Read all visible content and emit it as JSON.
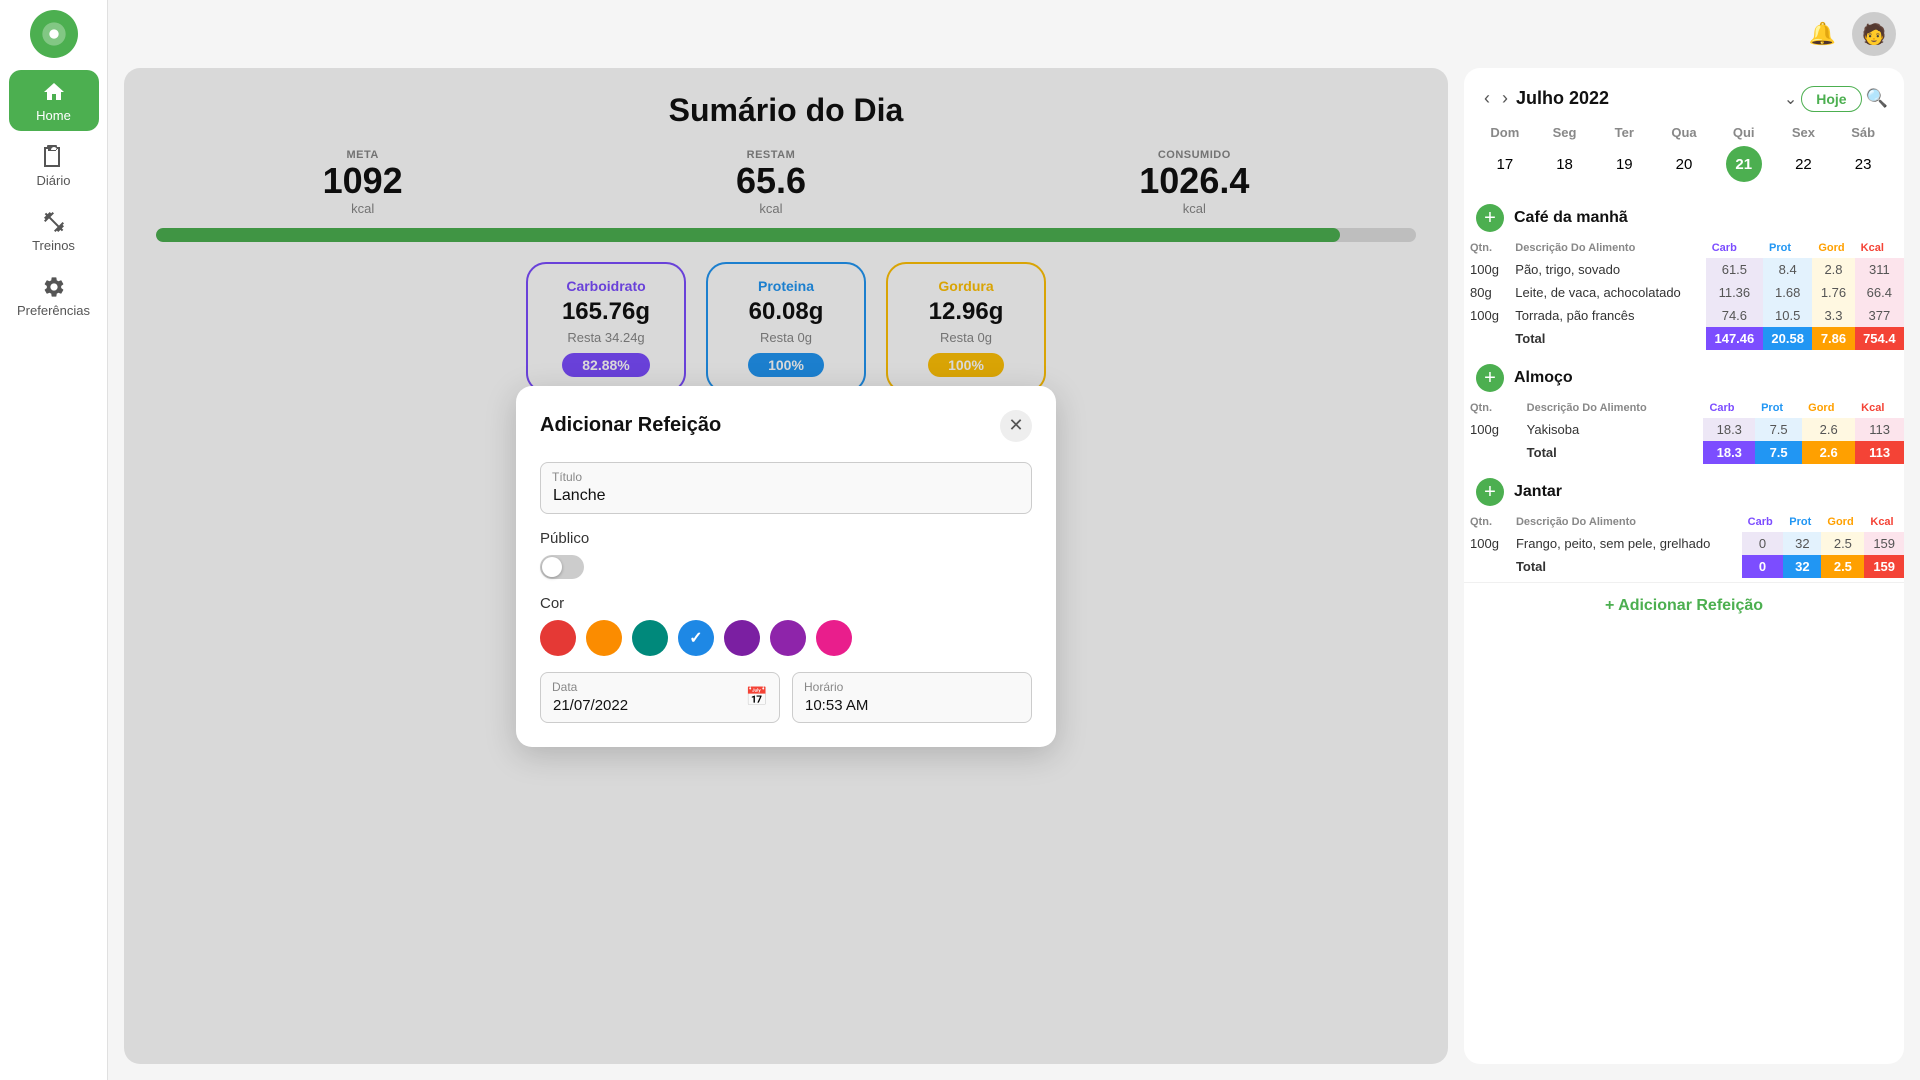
{
  "sidebar": {
    "logo_alt": "App Logo",
    "items": [
      {
        "id": "home",
        "label": "Home",
        "active": true
      },
      {
        "id": "diario",
        "label": "Diário",
        "active": false
      },
      {
        "id": "treinos",
        "label": "Treinos",
        "active": false
      },
      {
        "id": "preferencias",
        "label": "Preferências",
        "active": false
      }
    ]
  },
  "header": {
    "bell_icon": "🔔",
    "avatar_icon": "👤"
  },
  "summary": {
    "title": "Sumário do Dia",
    "meta_label": "META",
    "meta_value": "1092",
    "meta_unit": "kcal",
    "restam_label": "RESTAM",
    "restam_value": "65.6",
    "restam_unit": "kcal",
    "consumido_label": "CONSUMIDO",
    "consumido_value": "1026.4",
    "consumido_unit": "kcal",
    "progress_percent": 94,
    "macros": [
      {
        "id": "carb",
        "name": "Carboidrato",
        "value": "165.76g",
        "rest": "Resta 34.24g",
        "pct": "82.88%"
      },
      {
        "id": "prot",
        "name": "Proteina",
        "value": "60.08g",
        "rest": "Resta 0g",
        "pct": "100%"
      },
      {
        "id": "gord",
        "name": "Gordura",
        "value": "12.96g",
        "rest": "Resta 0g",
        "pct": "100%"
      }
    ]
  },
  "modal": {
    "title": "Adicionar Refeição",
    "titulo_label": "Título",
    "titulo_value": "Lanche",
    "publico_label": "Público",
    "cor_label": "Cor",
    "colors": [
      {
        "id": "red",
        "hex": "#e53935",
        "selected": false
      },
      {
        "id": "orange",
        "hex": "#fb8c00",
        "selected": false
      },
      {
        "id": "green",
        "hex": "#00897b",
        "selected": false
      },
      {
        "id": "blue-check",
        "hex": "#1e88e5",
        "selected": true
      },
      {
        "id": "purple",
        "hex": "#7b1fa2",
        "selected": false
      },
      {
        "id": "violet",
        "hex": "#8e24aa",
        "selected": false
      },
      {
        "id": "pink",
        "hex": "#e91e8c",
        "selected": false
      }
    ],
    "data_label": "Data",
    "data_value": "21/07/2022",
    "horario_label": "Horário",
    "horario_value": "10:53 AM"
  },
  "calendar": {
    "month_year": "Julho 2022",
    "today_btn": "Hoje",
    "day_headers": [
      "Dom",
      "Seg",
      "Ter",
      "Qua",
      "Qui",
      "Sex",
      "Sáb"
    ],
    "days": [
      17,
      18,
      19,
      20,
      21,
      22,
      23
    ],
    "today_day": 21
  },
  "meals": [
    {
      "id": "cafe",
      "name": "Café da manhã",
      "headers": {
        "qtn": "Qtn.",
        "desc": "Descrição Do Alimento",
        "carb": "Carb",
        "prot": "Prot",
        "gord": "Gord",
        "kcal": "Kcal"
      },
      "items": [
        {
          "qtn": "100g",
          "desc": "Pão, trigo, sovado",
          "carb": "61.5",
          "prot": "8.4",
          "gord": "2.8",
          "kcal": "311"
        },
        {
          "qtn": "80g",
          "desc": "Leite, de vaca, achocolatado",
          "carb": "11.36",
          "prot": "1.68",
          "gord": "1.76",
          "kcal": "66.4"
        },
        {
          "qtn": "100g",
          "desc": "Torrada, pão francês",
          "carb": "74.6",
          "prot": "10.5",
          "gord": "3.3",
          "kcal": "377"
        }
      ],
      "total": {
        "label": "Total",
        "carb": "147.46",
        "prot": "20.58",
        "gord": "7.86",
        "kcal": "754.4"
      }
    },
    {
      "id": "almoco",
      "name": "Almoço",
      "headers": {
        "qtn": "Qtn.",
        "desc": "Descrição Do Alimento",
        "carb": "Carb",
        "prot": "Prot",
        "gord": "Gord",
        "kcal": "Kcal"
      },
      "items": [
        {
          "qtn": "100g",
          "desc": "Yakisoba",
          "carb": "18.3",
          "prot": "7.5",
          "gord": "2.6",
          "kcal": "113"
        }
      ],
      "total": {
        "label": "Total",
        "carb": "18.3",
        "prot": "7.5",
        "gord": "2.6",
        "kcal": "113"
      }
    },
    {
      "id": "jantar",
      "name": "Jantar",
      "headers": {
        "qtn": "Qtn.",
        "desc": "Descrição Do Alimento",
        "carb": "Carb",
        "prot": "Prot",
        "gord": "Gord",
        "kcal": "Kcal"
      },
      "items": [
        {
          "qtn": "100g",
          "desc": "Frango, peito, sem pele, grelhado",
          "carb": "0",
          "prot": "32",
          "gord": "2.5",
          "kcal": "159"
        }
      ],
      "total": {
        "label": "Total",
        "carb": "0",
        "prot": "32",
        "gord": "2.5",
        "kcal": "159"
      }
    }
  ],
  "add_refeicao_label": "+ Adicionar Refeição"
}
